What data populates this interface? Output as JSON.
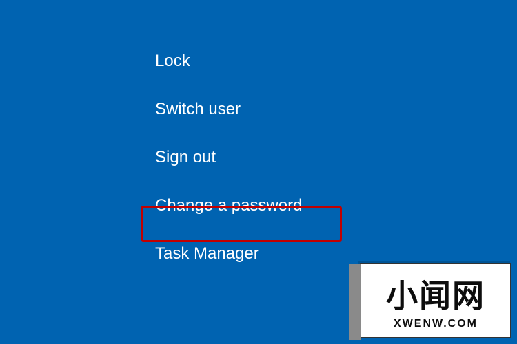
{
  "menu": {
    "items": [
      {
        "label": "Lock"
      },
      {
        "label": "Switch user"
      },
      {
        "label": "Sign out"
      },
      {
        "label": "Change a password"
      },
      {
        "label": "Task Manager"
      }
    ],
    "highlighted_index": 3
  },
  "watermark": {
    "main_text": "小闻网",
    "sub_text": "XWENW.COM"
  },
  "colors": {
    "background": "#0063b1",
    "menu_text": "#ffffff",
    "highlight_border": "#c20000"
  }
}
